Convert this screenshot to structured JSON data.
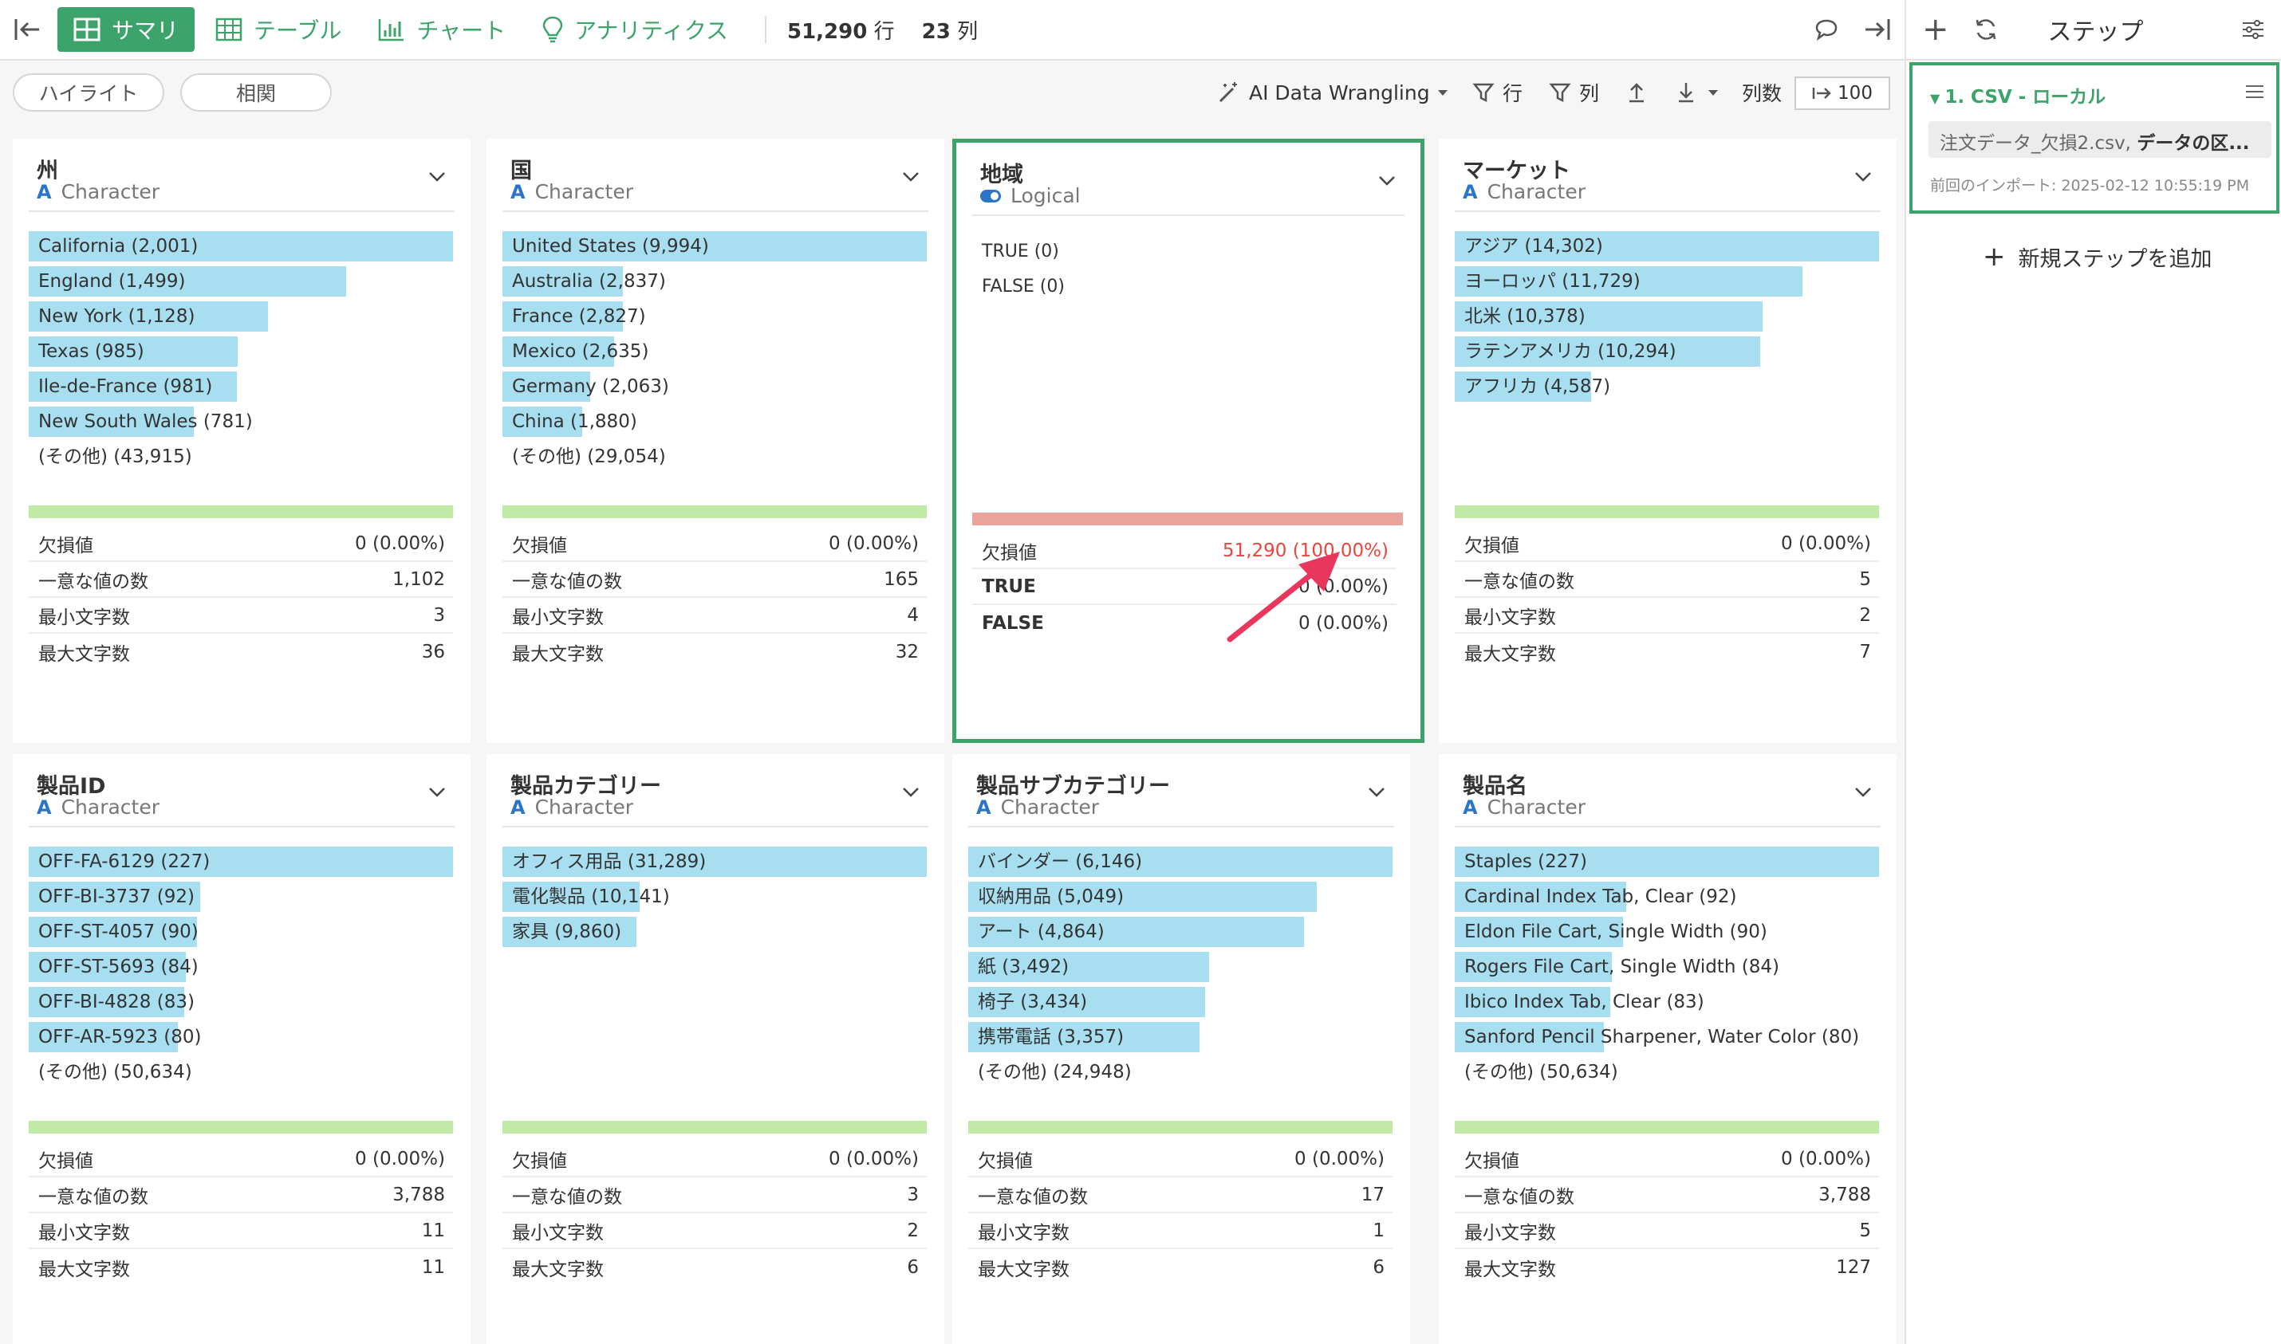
{
  "topbar": {
    "tabs": [
      {
        "label": "サマリ",
        "icon": "summary-grid-icon",
        "active": true
      },
      {
        "label": "テーブル",
        "icon": "table-icon",
        "active": false
      },
      {
        "label": "チャート",
        "icon": "chart-icon",
        "active": false
      },
      {
        "label": "アナリティクス",
        "icon": "lightbulb-icon",
        "active": false
      }
    ],
    "rows_count": "51,290",
    "rows_unit": "行",
    "cols_count": "23",
    "cols_unit": "列"
  },
  "toolbar": {
    "highlight_label": "ハイライト",
    "correlation_label": "相関",
    "ai_label": "AI Data Wrangling",
    "filter_row_label": "行",
    "filter_col_label": "列",
    "col_count_label": "列数",
    "col_count_value": "100"
  },
  "right_panel": {
    "title": "ステップ",
    "step": {
      "title": "1. CSV - ローカル",
      "file_prefix": "注文データ_欠損2.csv, ",
      "file_bold": "データの区...",
      "date": "前回のインポート: 2025-02-12 10:55:19 PM"
    },
    "add_step_label": "新規ステップを追加"
  },
  "colors": {
    "accent": "#3ca36a",
    "bar": "#a8dff0",
    "ok_bar": "#bfe9a4",
    "missing_bar": "#eba49c",
    "missing_text": "#e8463c",
    "arrow": "#e8365d"
  },
  "cards": [
    {
      "title": "州",
      "type": "Character",
      "bars": [
        {
          "label": "California (2,001)",
          "fraction": 1.0
        },
        {
          "label": "England (1,499)",
          "fraction": 0.749
        },
        {
          "label": "New York (1,128)",
          "fraction": 0.564
        },
        {
          "label": "Texas (985)",
          "fraction": 0.492
        },
        {
          "label": "Ile-de-France (981)",
          "fraction": 0.49
        },
        {
          "label": "New South Wales (781)",
          "fraction": 0.39
        }
      ],
      "other": "(その他) (43,915)",
      "stats": [
        {
          "k": "欠損値",
          "v": "0 (0.00%)"
        },
        {
          "k": "一意な値の数",
          "v": "1,102"
        },
        {
          "k": "最小文字数",
          "v": "3"
        },
        {
          "k": "最大文字数",
          "v": "36"
        }
      ]
    },
    {
      "title": "国",
      "type": "Character",
      "bars": [
        {
          "label": "United States (9,994)",
          "fraction": 1.0
        },
        {
          "label": "Australia (2,837)",
          "fraction": 0.284
        },
        {
          "label": "France (2,827)",
          "fraction": 0.283
        },
        {
          "label": "Mexico (2,635)",
          "fraction": 0.264
        },
        {
          "label": "Germany (2,063)",
          "fraction": 0.206
        },
        {
          "label": "China (1,880)",
          "fraction": 0.188
        }
      ],
      "other": "(その他) (29,054)",
      "stats": [
        {
          "k": "欠損値",
          "v": "0 (0.00%)"
        },
        {
          "k": "一意な値の数",
          "v": "165"
        },
        {
          "k": "最小文字数",
          "v": "4"
        },
        {
          "k": "最大文字数",
          "v": "32"
        }
      ]
    },
    {
      "title": "地域",
      "type": "Logical",
      "values": [
        "TRUE (0)",
        "FALSE (0)"
      ],
      "stats": [
        {
          "k": "欠損値",
          "v": "51,290 (100.00%)"
        },
        {
          "k": "TRUE",
          "v": "0 (0.00%)"
        },
        {
          "k": "FALSE",
          "v": "0 (0.00%)"
        }
      ]
    },
    {
      "title": "マーケット",
      "type": "Character",
      "bars": [
        {
          "label": "アジア (14,302)",
          "fraction": 1.0
        },
        {
          "label": "ヨーロッパ (11,729)",
          "fraction": 0.82
        },
        {
          "label": "北米 (10,378)",
          "fraction": 0.726
        },
        {
          "label": "ラテンアメリカ (10,294)",
          "fraction": 0.72
        },
        {
          "label": "アフリカ (4,587)",
          "fraction": 0.321
        }
      ],
      "other": "",
      "stats": [
        {
          "k": "欠損値",
          "v": "0 (0.00%)"
        },
        {
          "k": "一意な値の数",
          "v": "5"
        },
        {
          "k": "最小文字数",
          "v": "2"
        },
        {
          "k": "最大文字数",
          "v": "7"
        }
      ]
    },
    {
      "title": "製品ID",
      "type": "Character",
      "bars": [
        {
          "label": "OFF-FA-6129 (227)",
          "fraction": 1.0
        },
        {
          "label": "OFF-BI-3737 (92)",
          "fraction": 0.405
        },
        {
          "label": "OFF-ST-4057 (90)",
          "fraction": 0.396
        },
        {
          "label": "OFF-ST-5693 (84)",
          "fraction": 0.37
        },
        {
          "label": "OFF-BI-4828 (83)",
          "fraction": 0.366
        },
        {
          "label": "OFF-AR-5923 (80)",
          "fraction": 0.352
        }
      ],
      "other": "(その他) (50,634)",
      "stats": [
        {
          "k": "欠損値",
          "v": "0 (0.00%)"
        },
        {
          "k": "一意な値の数",
          "v": "3,788"
        },
        {
          "k": "最小文字数",
          "v": "11"
        },
        {
          "k": "最大文字数",
          "v": "11"
        }
      ]
    },
    {
      "title": "製品カテゴリー",
      "type": "Character",
      "bars": [
        {
          "label": "オフィス用品 (31,289)",
          "fraction": 1.0
        },
        {
          "label": "電化製品 (10,141)",
          "fraction": 0.324
        },
        {
          "label": "家具 (9,860)",
          "fraction": 0.315
        }
      ],
      "other": "",
      "stats": [
        {
          "k": "欠損値",
          "v": "0 (0.00%)"
        },
        {
          "k": "一意な値の数",
          "v": "3"
        },
        {
          "k": "最小文字数",
          "v": "2"
        },
        {
          "k": "最大文字数",
          "v": "6"
        }
      ]
    },
    {
      "title": "製品サブカテゴリー",
      "type": "Character",
      "bars": [
        {
          "label": "バインダー (6,146)",
          "fraction": 1.0
        },
        {
          "label": "収納用品 (5,049)",
          "fraction": 0.822
        },
        {
          "label": "アート (4,864)",
          "fraction": 0.791
        },
        {
          "label": "紙 (3,492)",
          "fraction": 0.568
        },
        {
          "label": "椅子 (3,434)",
          "fraction": 0.559
        },
        {
          "label": "携帯電話 (3,357)",
          "fraction": 0.546
        }
      ],
      "other": "(その他) (24,948)",
      "stats": [
        {
          "k": "欠損値",
          "v": "0 (0.00%)"
        },
        {
          "k": "一意な値の数",
          "v": "17"
        },
        {
          "k": "最小文字数",
          "v": "1"
        },
        {
          "k": "最大文字数",
          "v": "6"
        }
      ]
    },
    {
      "title": "製品名",
      "type": "Character",
      "bars": [
        {
          "label": "Staples (227)",
          "fraction": 1.0
        },
        {
          "label": "Cardinal Index Tab, Clear (92)",
          "fraction": 0.405
        },
        {
          "label": "Eldon File Cart, Single Width (90)",
          "fraction": 0.396
        },
        {
          "label": "Rogers File Cart, Single Width (84)",
          "fraction": 0.37
        },
        {
          "label": "Ibico Index Tab, Clear (83)",
          "fraction": 0.366
        },
        {
          "label": "Sanford Pencil Sharpener, Water Color (80)",
          "fraction": 0.352
        }
      ],
      "other": "(その他) (50,634)",
      "stats": [
        {
          "k": "欠損値",
          "v": "0 (0.00%)"
        },
        {
          "k": "一意な値の数",
          "v": "3,788"
        },
        {
          "k": "最小文字数",
          "v": "5"
        },
        {
          "k": "最大文字数",
          "v": "127"
        }
      ]
    }
  ]
}
